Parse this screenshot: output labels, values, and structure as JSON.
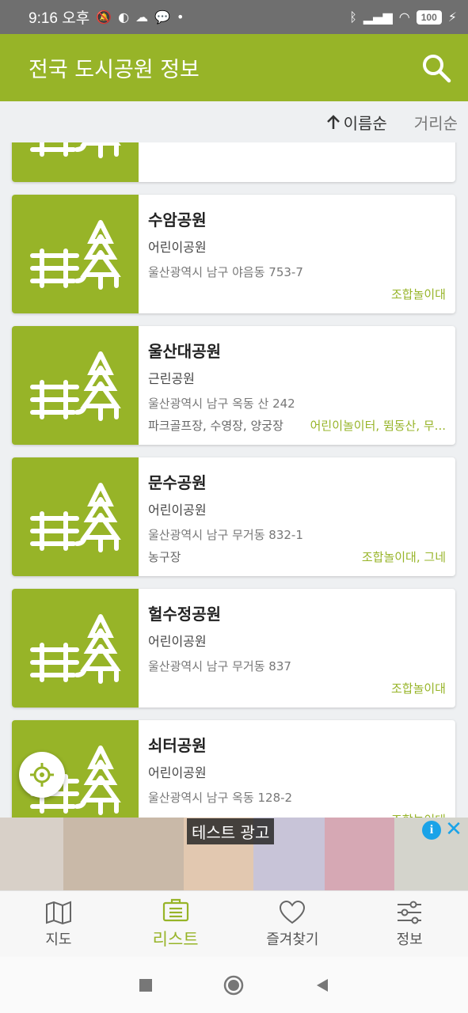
{
  "status": {
    "time": "9:16 오후",
    "battery": "100"
  },
  "app": {
    "title": "전국 도시공원 정보"
  },
  "sort": {
    "name_label": "이름순",
    "distance_label": "거리순"
  },
  "parks": [
    {
      "name": "",
      "type": "",
      "address": "",
      "facilities": "",
      "play": ""
    },
    {
      "name": "수암공원",
      "type": "어린이공원",
      "address": "울산광역시 남구 야음동 753-7",
      "facilities": "",
      "play": "조합놀이대"
    },
    {
      "name": "울산대공원",
      "type": "근린공원",
      "address": "울산광역시 남구 옥동 산 242",
      "facilities": "파크골프장, 수영장, 양궁장",
      "play": "어린이놀이터, 뜀동산, 무..."
    },
    {
      "name": "문수공원",
      "type": "어린이공원",
      "address": "울산광역시 남구 무거동 832-1",
      "facilities": "농구장",
      "play": "조합놀이대, 그네"
    },
    {
      "name": "헐수정공원",
      "type": "어린이공원",
      "address": "울산광역시 남구 무거동 837",
      "facilities": "",
      "play": "조합놀이대"
    },
    {
      "name": "쇠터공원",
      "type": "어린이공원",
      "address": "울산광역시 남구 옥동 128-2",
      "facilities": "",
      "play": "조합놀이대"
    }
  ],
  "ad": {
    "label": "테스트 광고",
    "info": "i",
    "close": "✕"
  },
  "nav": {
    "map": "지도",
    "list": "리스트",
    "favorites": "즐겨찾기",
    "info": "정보"
  },
  "colors": {
    "brand": "#97b428",
    "status_bar": "#6f6f6f"
  }
}
